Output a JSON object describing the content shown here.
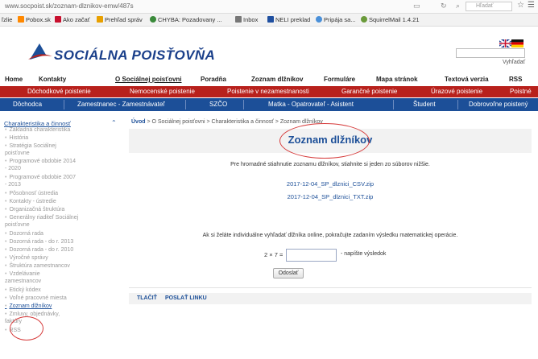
{
  "browser": {
    "url": "www.socpoist.sk/zoznam-dlznikov-emw/487s",
    "find_placeholder": "Hľadať"
  },
  "bookmarks": [
    {
      "label": "ľzlie",
      "color": "#ffffff"
    },
    {
      "label": "Pobox.sk",
      "color": "#ff8800"
    },
    {
      "label": "Ako začať",
      "color": "#c8102e"
    },
    {
      "label": "Prehľad správ",
      "color": "#e8a000"
    },
    {
      "label": "CHYBA: Pozadovany ...",
      "color": "#3a8a3a"
    },
    {
      "label": "Inbox",
      "color": "#777777"
    },
    {
      "label": "NELI preklad",
      "color": "#1f4fa0"
    },
    {
      "label": "Pripája sa...",
      "color": "#4a90d9"
    },
    {
      "label": "SquirrelMail 1.4.21",
      "color": "#6a9a3a"
    }
  ],
  "header": {
    "logo_text": "SOCIÁLNA POISŤOVŇA",
    "search_label": "Vyhľadať"
  },
  "top_nav": [
    "Home",
    "Kontakty",
    "O Sociálnej poisťovni",
    "Poradňa",
    "Zoznam dlžníkov",
    "Formuláre",
    "Mapa stránok",
    "Textová verzia",
    "RSS"
  ],
  "red_nav": [
    "Dôchodkové poistenie",
    "Nemocenské poistenie",
    "Poistenie v nezamestnanosti",
    "Garančné poistenie",
    "Úrazové poistenie",
    "Poistné"
  ],
  "blue_nav": [
    "Dôchodca",
    "Zamestnanec - Zamestnávateľ",
    "SZČO",
    "Matka - Opatrovateľ - Asistent",
    "Študent",
    "Dobrovoľne poistený"
  ],
  "sidebar": {
    "title": "Charakteristika a činnosť",
    "items": [
      "Základná charakteristika",
      "História",
      "Stratégia Sociálnej poisťovne",
      "Programové obdobie 2014 - 2020",
      "Programové obdobie 2007 - 2013",
      "Pôsobnosť ústredia",
      "Kontakty - ústredie",
      "Organizačná štruktúra",
      "Generálny riaditeľ Sociálnej poisťovne",
      "Dozorná rada",
      "Dozorná rada - do r. 2013",
      "Dozorná rada - do r. 2010",
      "Výročné správy",
      "Štruktúra zamestnancov",
      "Vzdelávanie zamestnancov",
      "Etický kódex",
      "Voľné pracovné miesta",
      "Zoznam dlžníkov",
      "Zmluvy, objednávky, faktúry",
      "RSS"
    ]
  },
  "content": {
    "breadcrumb_home": "Úvod",
    "breadcrumb_rest": "> O Sociálnej poisťovni > Charakteristika a činnosť > Zoznam dlžníkov",
    "title": "Zoznam dlžníkov",
    "intro": "Pre hromadné stiahnutie zoznamu dlžníkov, stiahnite si jeden zo súborov nižšie.",
    "files": [
      "2017-12-04_SP_dlznici_CSV.zip",
      "2017-12-04_SP_dlznici_TXT.zip"
    ],
    "online_text": "Ak si želáte individuálne vyhľadať dlžníka online, pokračujte zadaním výsledku matematickej operácie.",
    "captcha_question": "2 × 7 =",
    "captcha_value": "",
    "captcha_hint": "- napíšte výsledok",
    "submit_label": "Odoslať",
    "print_label": "TLAČIŤ",
    "send_link_label": "POSLAŤ LINKU"
  },
  "colors": {
    "brand_blue": "#1c4f98",
    "brand_red": "#b8211c",
    "annotation_red": "#d63b3b"
  }
}
